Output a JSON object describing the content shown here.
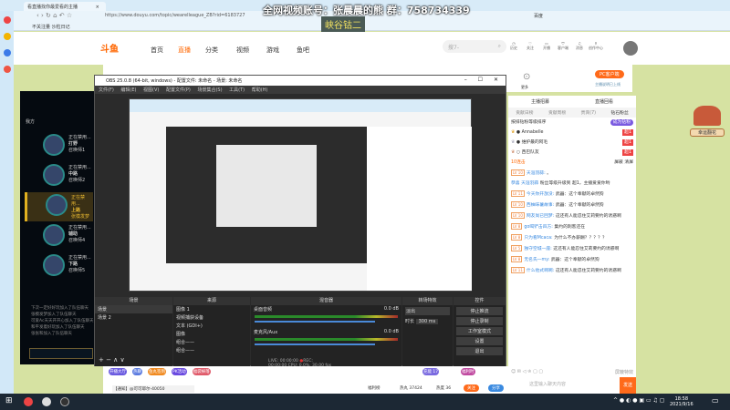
{
  "browser": {
    "tab_title": "看直播找你最爱看的主播",
    "url": "https://www.douyu.com/topic/wearelleague_ZB?rid=6183727",
    "bookmark": "不关注量 沙粒日记",
    "search_engine": "百度"
  },
  "overlay": {
    "line1": "全网视频账号：张晨晨的熊  群：758734339",
    "line2": "峡谷钴二"
  },
  "site": {
    "logo": "斗鱼",
    "nav": [
      "首页",
      "直播",
      "分类",
      "视频",
      "游戏",
      "鱼吧"
    ],
    "search_placeholder": "搜7-",
    "header_icons": [
      "历史",
      "关注",
      "开播",
      "客户端",
      "消息",
      "创作中心"
    ],
    "pc_client": "PC客户端",
    "pc_sub": "主播说明已上线",
    "more": "更多"
  },
  "game": {
    "header": "我方",
    "players": [
      {
        "status": "正在禁用...",
        "role": "打野",
        "name": "召唤师1"
      },
      {
        "status": "正在禁用...",
        "role": "中路",
        "name": "召唤师2"
      },
      {
        "status": "正在禁用...",
        "role": "上路",
        "name": "张模发梦"
      },
      {
        "status": "正在禁用...",
        "role": "辅助",
        "name": "召唤师4"
      },
      {
        "status": "正在禁用...",
        "role": "下路",
        "name": "召唤师5"
      }
    ],
    "messages": [
      "下次一定好好玩加入了队伍聊天",
      "张模发梦加入了队伍聊天",
      "可爱Ac天天开开心加入了队伍聊天",
      "和平发着好玩加入了队伍聊天",
      "张张和加入了队伍聊天"
    ]
  },
  "obs": {
    "title": "OBS 25.0.8 (64-bit, windows) - 配置文件: 未命名 - 场景: 未命名",
    "menu": [
      "文件(F)",
      "编辑(E)",
      "视图(V)",
      "配置文件(P)",
      "场景集合(S)",
      "工具(T)",
      "帮助(H)"
    ],
    "docks": {
      "scenes": {
        "title": "场景",
        "items": [
          "场景",
          "场景 2"
        ]
      },
      "sources": {
        "title": "来源",
        "items": [
          "图像 1",
          "视频捕获设备",
          "文本 (GDI+)",
          "图像",
          "组合——",
          "组合——"
        ]
      },
      "mixer": {
        "title": "混音器",
        "tracks": [
          {
            "name": "桌面音频",
            "db": "0.0 dB"
          },
          {
            "name": "麦克风/Aux",
            "db": "0.0 dB"
          }
        ]
      },
      "transitions": {
        "title": "转场特效",
        "type": "淡出",
        "duration_label": "时长",
        "duration": "300 ms"
      },
      "controls": {
        "title": "控件",
        "buttons": [
          "停止推流",
          "停止录制",
          "工作室模式",
          "设置",
          "退出"
        ]
      }
    },
    "status": {
      "live": "LIVE: 00:00:00",
      "rec": "REC: 00:00:00",
      "cpu": "CPU: 0.0%, 30.00 fps",
      "delay": "延迟 (0) 26 秒后开始)"
    }
  },
  "chat": {
    "tabs_top": [
      "主播招募",
      "直播回看"
    ],
    "tabs": [
      "贡献日榜",
      "贡献周榜",
      "贵宾(7)",
      "钻石粉丝"
    ],
    "rank_hint": "按排钻粉等级排序",
    "rank_btn": "成为钻粉",
    "ranks": [
      {
        "name": "Annabelle",
        "badge": "超1"
      },
      {
        "name": "维护最的阿毛",
        "badge": "超1"
      },
      {
        "name": "西巴队友",
        "badge": "超1"
      }
    ],
    "combo": "10连击",
    "btn_block": "屏蔽",
    "btn_clear": "清屏",
    "messages": [
      {
        "lv": "LV 10",
        "user": "天涯羽蒜:",
        "text": "。"
      },
      {
        "lv": "",
        "user": "恭喜 天涯羽蒜",
        "text": "粉丝等级升级到 超1，主播爱爱你哟"
      },
      {
        "lv": "LV 11",
        "user": "今天你开放没:",
        "text": "武器：这个奉献的卓然狗"
      },
      {
        "lv": "LV 10",
        "user": "西柚味薯故事:",
        "text": "武器：这个奉献的卓然狗"
      },
      {
        "lv": "LV 10",
        "user": "网友尚已回梦:",
        "text": "这还有人能忍住艾莉要约的诱惑啊"
      },
      {
        "lv": "LV 8",
        "user": "go喝铲击四方:",
        "text": "集约的刺客还在"
      },
      {
        "lv": "LV 8",
        "user": "只为看Mcaca:",
        "text": "为什么不办薪酬？？？？？"
      },
      {
        "lv": "LV 5",
        "user": "独守空城一座:",
        "text": "这还有人能忍住艾莉要约的诱惑啊"
      },
      {
        "lv": "LV 8",
        "user": "无名氏一my:",
        "text": "武器：这个奉献的卓然狗"
      },
      {
        "lv": "LV 11",
        "user": "什么他式啊啊:",
        "text": "这还有人能忍住艾莉要约的诱惑啊"
      }
    ],
    "block_effects": "屏蔽特效",
    "input_placeholder": "这里输入聊天内容",
    "send": "发送",
    "promo": "幸运翻花"
  },
  "bottom": {
    "icons": [
      "开播大厅",
      "热聊",
      "鱼丸签到",
      "PK活动",
      "福袋掉落",
      "充能 17",
      "福利时"
    ],
    "notice": "【通知】@可可耶尔-40050",
    "fans_label": "福利榜",
    "heat": "热丸 37424",
    "fans": "热度 36",
    "follow": "关注",
    "share": "分享"
  },
  "taskbar": {
    "time": "18:58",
    "date": "2021/9/16"
  }
}
